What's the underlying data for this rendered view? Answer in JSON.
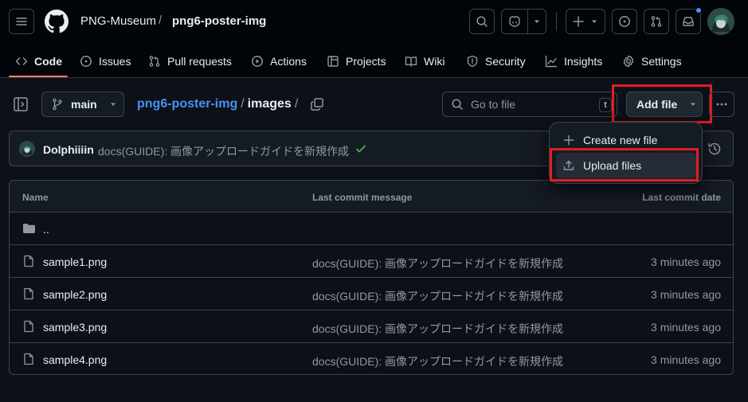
{
  "header": {
    "owner": "PNG-Museum",
    "separator": "/",
    "repo": "png6-poster-img",
    "has_notification": true
  },
  "nav": {
    "items": [
      {
        "label": "Code",
        "icon": "code-icon",
        "active": true
      },
      {
        "label": "Issues",
        "icon": "issue-opened-icon",
        "active": false
      },
      {
        "label": "Pull requests",
        "icon": "git-pull-request-icon",
        "active": false
      },
      {
        "label": "Actions",
        "icon": "play-icon",
        "active": false
      },
      {
        "label": "Projects",
        "icon": "table-icon",
        "active": false
      },
      {
        "label": "Wiki",
        "icon": "book-icon",
        "active": false
      },
      {
        "label": "Security",
        "icon": "shield-icon",
        "active": false
      },
      {
        "label": "Insights",
        "icon": "graph-icon",
        "active": false
      },
      {
        "label": "Settings",
        "icon": "gear-icon",
        "active": false
      }
    ]
  },
  "toolbar": {
    "branch": "main",
    "path_repo": "png6-poster-img",
    "path_sep": "/",
    "path_folder": "images",
    "path_trailing": "/",
    "goto_placeholder": "Go to file",
    "goto_shortcut": "t",
    "add_file_label": "Add file"
  },
  "commit": {
    "author": "Dolphiiiin",
    "message": "docs(GUIDE): 画像アップロードガイドを新規作成",
    "status": "success"
  },
  "table": {
    "headers": {
      "name": "Name",
      "message": "Last commit message",
      "date": "Last commit date"
    },
    "parent_row": "..",
    "rows": [
      {
        "name": "sample1.png",
        "message": "docs(GUIDE): 画像アップロードガイドを新規作成",
        "date": "3 minutes ago"
      },
      {
        "name": "sample2.png",
        "message": "docs(GUIDE): 画像アップロードガイドを新規作成",
        "date": "3 minutes ago"
      },
      {
        "name": "sample3.png",
        "message": "docs(GUIDE): 画像アップロードガイドを新規作成",
        "date": "3 minutes ago"
      },
      {
        "name": "sample4.png",
        "message": "docs(GUIDE): 画像アップロードガイドを新規作成",
        "date": "3 minutes ago"
      }
    ]
  },
  "dropdown": {
    "items": [
      {
        "label": "Create new file",
        "icon": "plus-icon"
      },
      {
        "label": "Upload files",
        "icon": "upload-icon",
        "highlighted": true
      }
    ]
  },
  "colors": {
    "background": "#0d1117",
    "header_bg": "#010409",
    "accent_link": "#4493f8",
    "active_tab_underline": "#f78166",
    "highlight_box": "#e11d26",
    "success": "#3fb950"
  }
}
